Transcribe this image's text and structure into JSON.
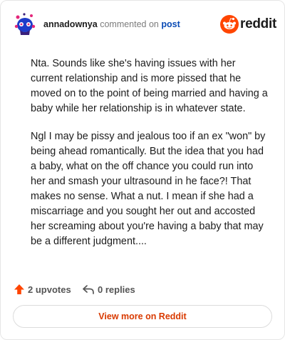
{
  "comment": {
    "username": "annadownya",
    "verb": "commented on",
    "post_link": "post",
    "paragraphs": [
      "Nta. Sounds like she's having issues with her current relationship and is more pissed that he moved on to the point of being married and having a baby while her relationship is in whatever state.",
      "Ngl I may be pissy and jealous too if an ex \"won\" by being ahead romantically. But the idea that you had a baby, what on the off chance you could run into her and smash your ultrasound in he face?! That makes no sense. What a nut. I mean if she had a miscarriage and you sought her out and accosted her screaming about you're having a baby that may be a different judgment...."
    ]
  },
  "brand": {
    "name": "reddit",
    "icon": "reddit-logo-icon",
    "color": "#ff4500"
  },
  "actions": {
    "upvotes": "2 upvotes",
    "replies": "0 replies",
    "upvote_color": "#ff4500"
  },
  "view_more": "View more on Reddit",
  "avatar": {
    "icon": "snoo-avatar-icon"
  }
}
